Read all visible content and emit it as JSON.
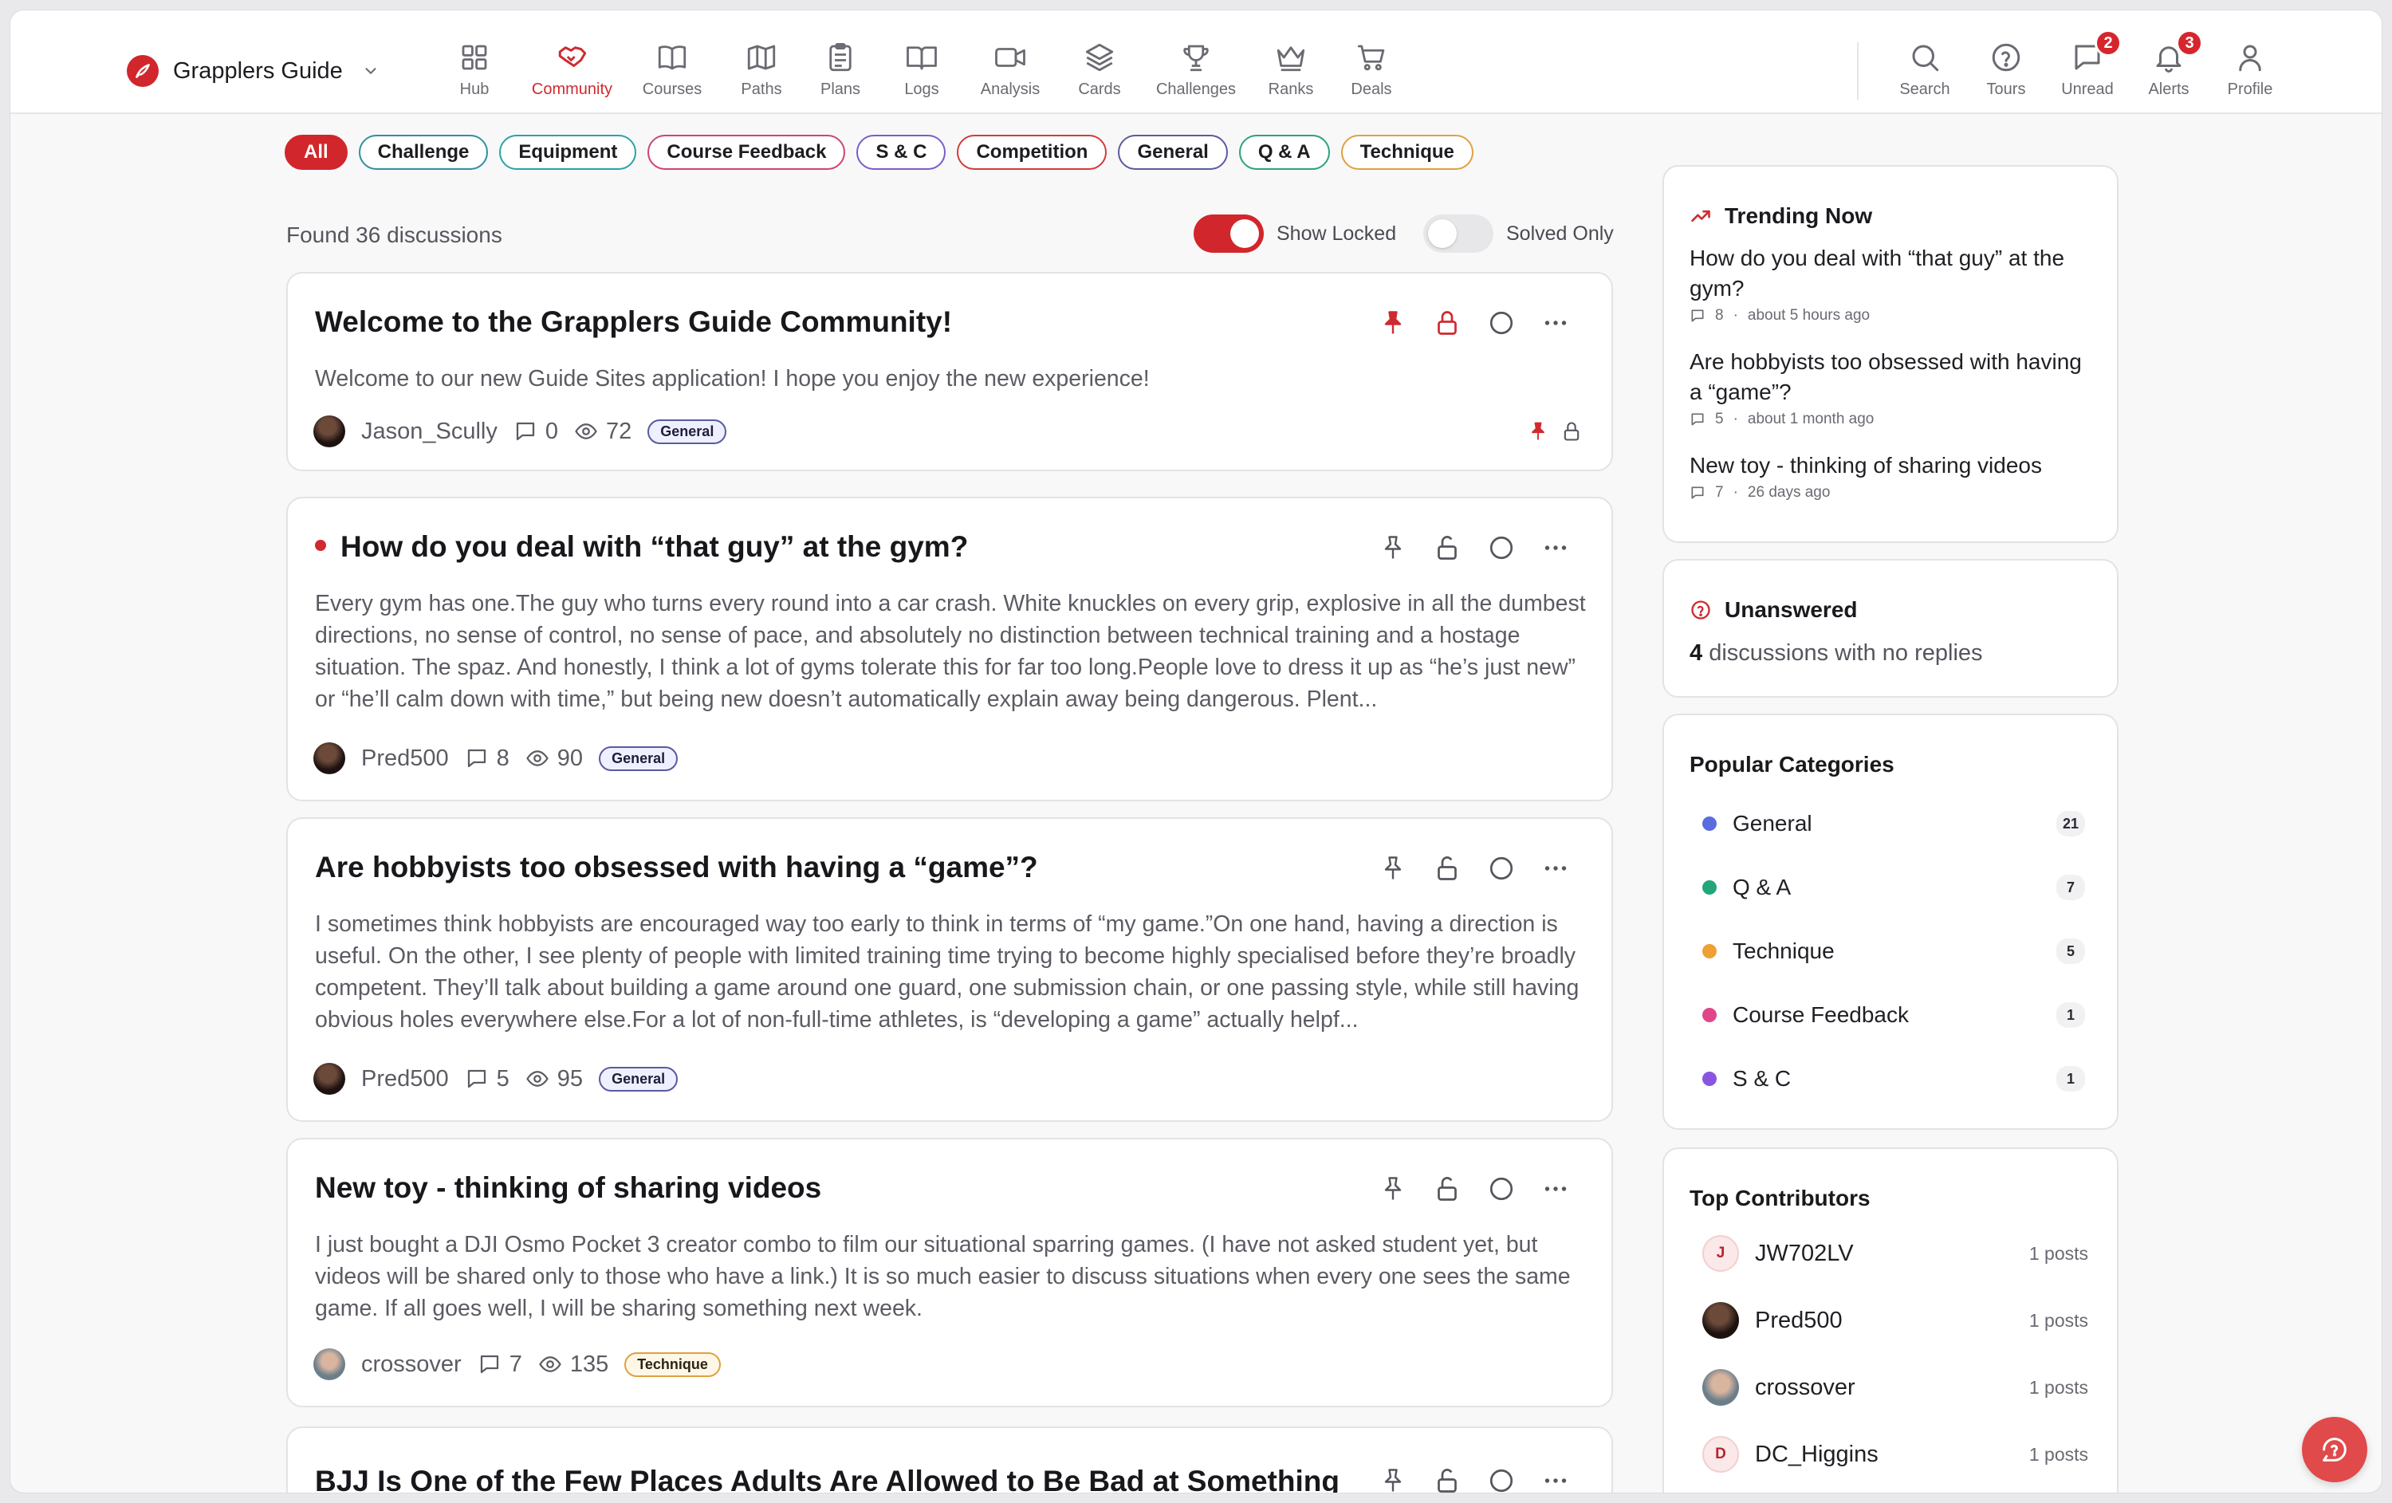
{
  "app": {
    "name": "Grapplers Guide",
    "colors": {
      "accent": "#d1262c",
      "bg": "#f8f8f9"
    }
  },
  "nav": [
    {
      "label": "Hub",
      "icon": "grid-icon"
    },
    {
      "label": "Community",
      "icon": "handshake-icon"
    },
    {
      "label": "Courses",
      "icon": "book-icon"
    },
    {
      "label": "Paths",
      "icon": "map-icon"
    },
    {
      "label": "Plans",
      "icon": "clipboard-icon"
    },
    {
      "label": "Logs",
      "icon": "book-open-icon"
    },
    {
      "label": "Analysis",
      "icon": "video-icon"
    },
    {
      "label": "Cards",
      "icon": "layers-icon"
    },
    {
      "label": "Challenges",
      "icon": "trophy-icon"
    },
    {
      "label": "Ranks",
      "icon": "crown-icon"
    },
    {
      "label": "Deals",
      "icon": "cart-icon"
    }
  ],
  "utilities": [
    {
      "label": "Search",
      "icon": "search-icon",
      "badge": ""
    },
    {
      "label": "Tours",
      "icon": "help-circle-icon",
      "badge": ""
    },
    {
      "label": "Unread",
      "icon": "message-icon",
      "badge": "2"
    },
    {
      "label": "Alerts",
      "icon": "bell-icon",
      "badge": "3"
    },
    {
      "label": "Profile",
      "icon": "user-icon",
      "badge": ""
    }
  ],
  "filters": [
    {
      "label": "All",
      "color": "#d1262c"
    },
    {
      "label": "Challenge",
      "color": "#2f8fa0"
    },
    {
      "label": "Equipment",
      "color": "#2aa3a3"
    },
    {
      "label": "Course Feedback",
      "color": "#d0436e"
    },
    {
      "label": "S & C",
      "color": "#7a5cc9"
    },
    {
      "label": "Competition",
      "color": "#d23b3b"
    },
    {
      "label": "General",
      "color": "#5a5a9e"
    },
    {
      "label": "Q & A",
      "color": "#2aa37a"
    },
    {
      "label": "Technique",
      "color": "#e0a040"
    }
  ],
  "found_text": "Found 36 discussions",
  "toggles": {
    "show_locked": "Show Locked",
    "solved_only": "Solved Only"
  },
  "discussions": [
    {
      "title": "Welcome to the Grapplers Guide Community!",
      "body": "Welcome to our new Guide Sites application! I hope you enjoy the new experience!",
      "author": "Jason_Scully",
      "comments": "0",
      "views": "72",
      "tag": "General"
    },
    {
      "title": "How do you deal with “that guy” at the gym?",
      "body": "Every gym has one.The guy who turns every round into a car crash. White knuckles on every grip, explosive in all the dumbest directions, no sense of control, no sense of pace, and absolutely no distinction between technical training and a hostage situation. The spaz. And honestly, I think a lot of gyms tolerate this for far too long.People love to dress it up as “he’s just new” or “he’ll calm down with time,” but being new doesn’t automatically explain away being dangerous. Plent...",
      "author": "Pred500",
      "comments": "8",
      "views": "90",
      "tag": "General"
    },
    {
      "title": "Are hobbyists too obsessed with having a “game”?",
      "body": "I sometimes think hobbyists are encouraged way too early to think in terms of “my game.”On one hand, having a direction is useful. On the other, I see plenty of people with limited training time trying to become highly specialised before they’re broadly competent. They’ll talk about building a game around one guard, one submission chain, or one passing style, while still having obvious holes everywhere else.For a lot of non-full-time athletes, is “developing a game” actually helpf...",
      "author": "Pred500",
      "comments": "5",
      "views": "95",
      "tag": "General"
    },
    {
      "title": "New toy - thinking of sharing videos",
      "body": "I just bought a DJI Osmo Pocket 3 creator combo to film our situational sparring games. (I have not asked student yet, but videos will be shared only to those who have a link.) It is so much easier to discuss situations when every one sees the same game. If all goes well, I will be sharing something next week.",
      "author": "crossover",
      "comments": "7",
      "views": "135",
      "tag": "Technique"
    },
    {
      "title": "BJJ Is One of the Few Places Adults Are Allowed to Be Bad at Something"
    }
  ],
  "trending": {
    "title": "Trending Now",
    "items": [
      {
        "question": "How do you deal with “that guy” at the gym?",
        "replies": "8",
        "time": "about 5 hours ago"
      },
      {
        "question": "Are hobbyists too obsessed with having a “game”?",
        "replies": "5",
        "time": "about 1 month ago"
      },
      {
        "question": "New toy - thinking of sharing videos",
        "replies": "7",
        "time": "26 days ago"
      }
    ]
  },
  "unanswered": {
    "title": "Unanswered",
    "count": "4",
    "text": "discussions with no replies"
  },
  "categories": {
    "title": "Popular Categories",
    "items": [
      {
        "name": "General",
        "count": "21",
        "color": "#5b6be0"
      },
      {
        "name": "Q & A",
        "count": "7",
        "color": "#22a57a"
      },
      {
        "name": "Technique",
        "count": "5",
        "color": "#eea032"
      },
      {
        "name": "Course Feedback",
        "count": "1",
        "color": "#e0468a"
      },
      {
        "name": "S & C",
        "count": "1",
        "color": "#8a55e0"
      }
    ]
  },
  "contributors": {
    "title": "Top Contributors",
    "items": [
      {
        "initial": "J",
        "name": "JW702LV",
        "posts": "1 posts"
      },
      {
        "initial": "",
        "name": "Pred500",
        "posts": "1 posts"
      },
      {
        "initial": "",
        "name": "crossover",
        "posts": "1 posts"
      },
      {
        "initial": "D",
        "name": "DC_Higgins",
        "posts": "1 posts"
      }
    ]
  }
}
